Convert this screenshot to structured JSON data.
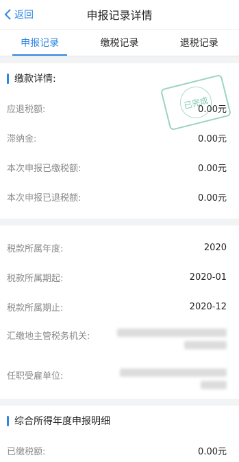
{
  "header": {
    "back_label": "返回",
    "title": "申报记录详情"
  },
  "tabs": [
    {
      "label": "申报记录",
      "active": true
    },
    {
      "label": "缴税记录",
      "active": false
    },
    {
      "label": "退税记录",
      "active": false
    }
  ],
  "payment_section": {
    "title": "缴款详情:",
    "stamp_text": "已完成",
    "rows": [
      {
        "label": "应退税额:",
        "value": "0.00元"
      },
      {
        "label": "滞纳金:",
        "value": "0.00元"
      },
      {
        "label": "本次申报已缴税额:",
        "value": "0.00元"
      },
      {
        "label": "本次申报已退税额:",
        "value": "0.00元"
      }
    ],
    "period_rows": [
      {
        "label": "税款所属年度:",
        "value": "2020"
      },
      {
        "label": "税款所属期起:",
        "value": "2020-01"
      },
      {
        "label": "税款所属期止:",
        "value": "2020-12"
      }
    ],
    "authority_label": "汇缴地主管税务机关:",
    "employer_label": "任职受雇单位:"
  },
  "annual_section": {
    "title": "综合所得年度申报明细",
    "rows": [
      {
        "label": "已缴税额:",
        "value": "0.00元"
      }
    ]
  },
  "colors": {
    "accent": "#2d87e2",
    "stamp": "#48af8c"
  }
}
